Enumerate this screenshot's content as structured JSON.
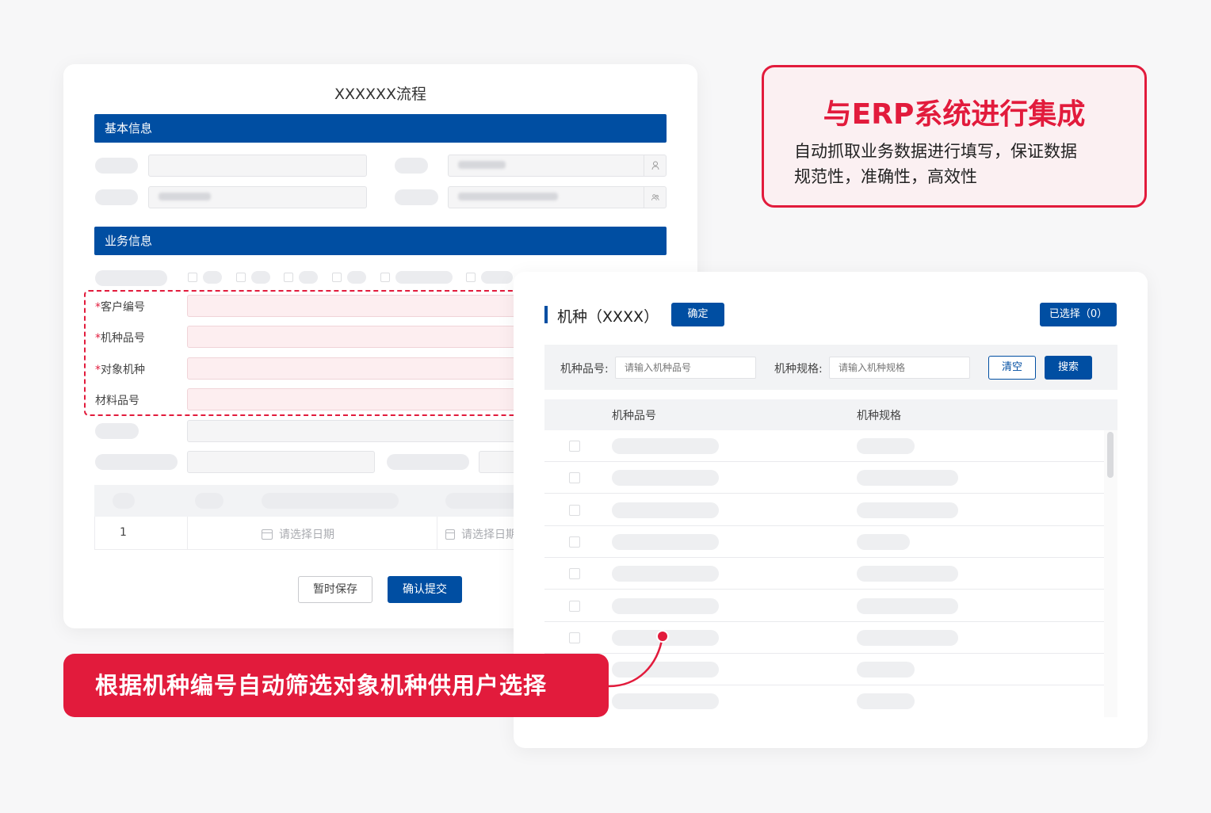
{
  "form": {
    "title": "XXXXXX流程",
    "section_basic": "基本信息",
    "section_business": "业务信息",
    "fields": {
      "customer_no": "客户编号",
      "model_part_no": "机种品号",
      "target_model": "对象机种",
      "material_no": "材料品号"
    },
    "required_mark": "*",
    "date_placeholder": "请选择日期",
    "row_index": "1",
    "save_label": "暂时保存",
    "submit_label": "确认提交"
  },
  "erp_callout": {
    "title": "与ERP系统进行集成",
    "desc_line1": "自动抓取业务数据进行填写，保证数据",
    "desc_line2": "规范性，准确性，高效性"
  },
  "selector": {
    "title": "机种（XXXX）",
    "confirm_label": "确定",
    "selected_label": "已选择（0）",
    "filter_model_no_label": "机种品号:",
    "filter_model_no_placeholder": "请输入机种品号",
    "filter_spec_label": "机种规格:",
    "filter_spec_placeholder": "请输入机种规格",
    "clear_label": "清空",
    "search_label": "搜索",
    "col_model_no": "机种品号",
    "col_spec": "机种规格"
  },
  "filter_callout": {
    "text": "根据机种编号自动筛选对象机种供用户选择"
  },
  "colors": {
    "brand_blue": "#004ea2",
    "accent_red": "#e21b3c"
  }
}
